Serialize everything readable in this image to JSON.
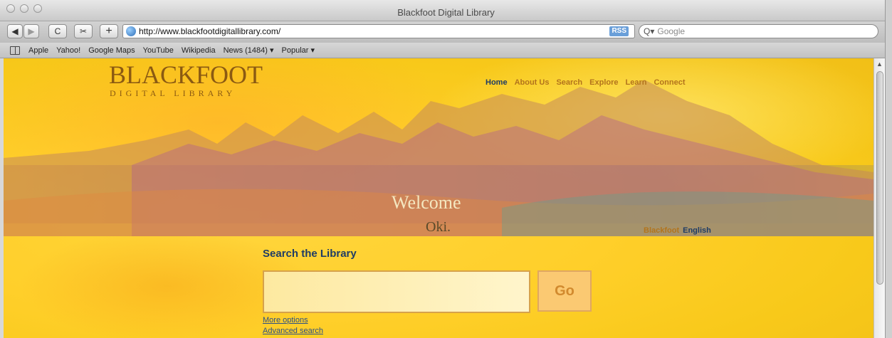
{
  "window": {
    "title": "Blackfoot Digital Library"
  },
  "toolbar": {
    "back": "◀",
    "forward": "▶",
    "reload": "C",
    "snip": "✂",
    "add": "+",
    "url": "http://www.blackfootdigitallibrary.com/",
    "rss": "RSS",
    "search_placeholder": "Google"
  },
  "bookmarks": [
    "Apple",
    "Yahoo!",
    "Google Maps",
    "YouTube",
    "Wikipedia",
    "News (1484) ▾",
    "Popular ▾"
  ],
  "site": {
    "logo_main": "BLACKFOOT",
    "logo_sub": "DIGITAL LIBRARY",
    "nav": [
      "Home",
      "About Us",
      "Search",
      "Explore",
      "Learn",
      "Connect"
    ],
    "welcome": "Welcome",
    "oki": "Oki.",
    "languages": {
      "blackfoot": "Blackfoot",
      "english": "English"
    },
    "search": {
      "heading": "Search the Library",
      "go": "Go",
      "more_options": "More options",
      "advanced": "Advanced search"
    }
  }
}
